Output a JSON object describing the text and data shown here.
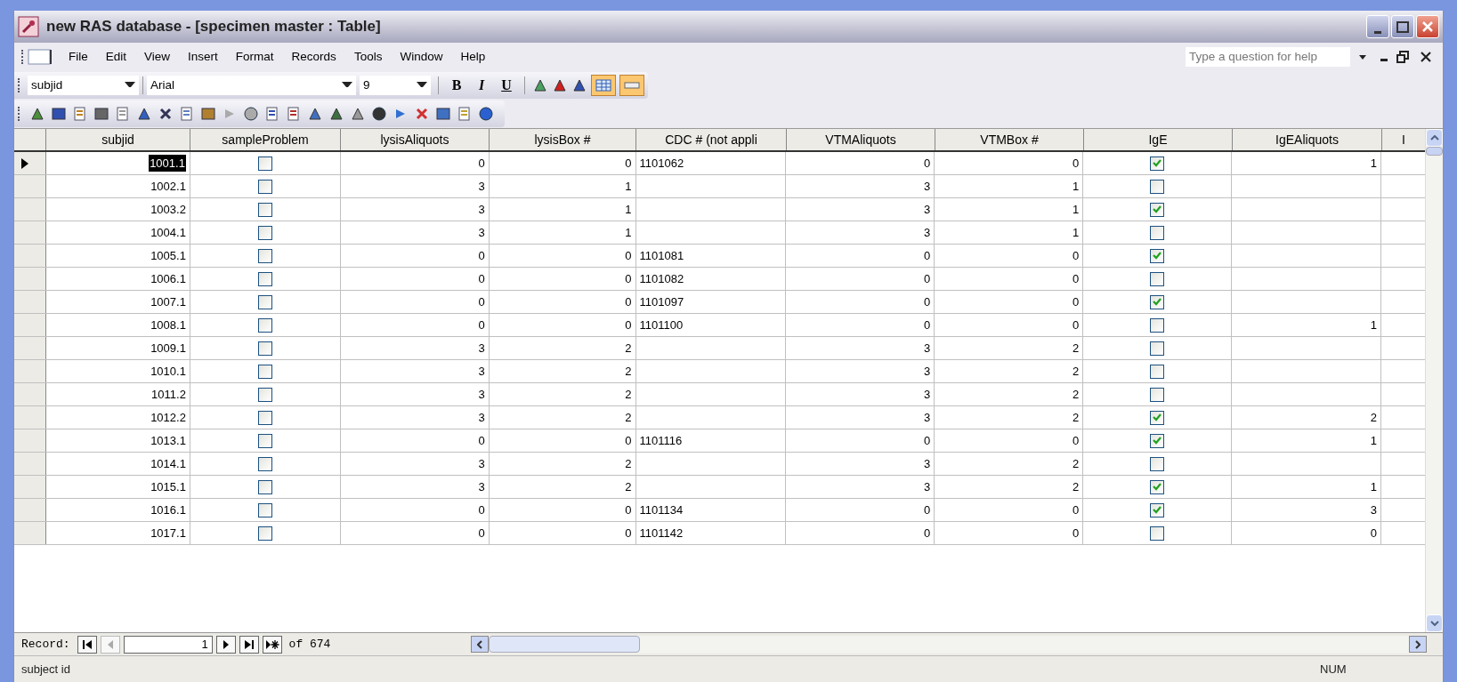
{
  "window": {
    "title": "new RAS database - [specimen master : Table]"
  },
  "menu": [
    {
      "label": "File"
    },
    {
      "label": "Edit"
    },
    {
      "label": "View"
    },
    {
      "label": "Insert"
    },
    {
      "label": "Format"
    },
    {
      "label": "Records"
    },
    {
      "label": "Tools"
    },
    {
      "label": "Window"
    },
    {
      "label": "Help"
    }
  ],
  "help_search": {
    "placeholder": "Type a question for help"
  },
  "formatting_toolbar": {
    "field": "subjid",
    "font": "Arial",
    "size": "9",
    "bold": "B",
    "italic": "I",
    "underline": "U"
  },
  "table": {
    "columns": [
      "subjid",
      "sampleProblem",
      "lysisAliquots",
      "lysisBox #",
      "CDC # (not appli",
      "VTMAliquots",
      "VTMBox #",
      "IgE",
      "IgEAliquots",
      "I"
    ],
    "rows": [
      {
        "selected": true,
        "subjid": "1001.1",
        "sample_problem": false,
        "lysis_aliquots": "0",
        "lysis_box": "0",
        "cdc": "1101062",
        "vtm_aliquots": "0",
        "vtm_box": "0",
        "ige": true,
        "ige_aliquots": "1"
      },
      {
        "selected": false,
        "subjid": "1002.1",
        "sample_problem": false,
        "lysis_aliquots": "3",
        "lysis_box": "1",
        "cdc": "",
        "vtm_aliquots": "3",
        "vtm_box": "1",
        "ige": false,
        "ige_aliquots": ""
      },
      {
        "selected": false,
        "subjid": "1003.2",
        "sample_problem": false,
        "lysis_aliquots": "3",
        "lysis_box": "1",
        "cdc": "",
        "vtm_aliquots": "3",
        "vtm_box": "1",
        "ige": true,
        "ige_aliquots": ""
      },
      {
        "selected": false,
        "subjid": "1004.1",
        "sample_problem": false,
        "lysis_aliquots": "3",
        "lysis_box": "1",
        "cdc": "",
        "vtm_aliquots": "3",
        "vtm_box": "1",
        "ige": false,
        "ige_aliquots": ""
      },
      {
        "selected": false,
        "subjid": "1005.1",
        "sample_problem": false,
        "lysis_aliquots": "0",
        "lysis_box": "0",
        "cdc": "1101081",
        "vtm_aliquots": "0",
        "vtm_box": "0",
        "ige": true,
        "ige_aliquots": ""
      },
      {
        "selected": false,
        "subjid": "1006.1",
        "sample_problem": false,
        "lysis_aliquots": "0",
        "lysis_box": "0",
        "cdc": "1101082",
        "vtm_aliquots": "0",
        "vtm_box": "0",
        "ige": false,
        "ige_aliquots": ""
      },
      {
        "selected": false,
        "subjid": "1007.1",
        "sample_problem": false,
        "lysis_aliquots": "0",
        "lysis_box": "0",
        "cdc": "1101097",
        "vtm_aliquots": "0",
        "vtm_box": "0",
        "ige": true,
        "ige_aliquots": ""
      },
      {
        "selected": false,
        "subjid": "1008.1",
        "sample_problem": false,
        "lysis_aliquots": "0",
        "lysis_box": "0",
        "cdc": "1101100",
        "vtm_aliquots": "0",
        "vtm_box": "0",
        "ige": false,
        "ige_aliquots": "1"
      },
      {
        "selected": false,
        "subjid": "1009.1",
        "sample_problem": false,
        "lysis_aliquots": "3",
        "lysis_box": "2",
        "cdc": "",
        "vtm_aliquots": "3",
        "vtm_box": "2",
        "ige": false,
        "ige_aliquots": ""
      },
      {
        "selected": false,
        "subjid": "1010.1",
        "sample_problem": false,
        "lysis_aliquots": "3",
        "lysis_box": "2",
        "cdc": "",
        "vtm_aliquots": "3",
        "vtm_box": "2",
        "ige": false,
        "ige_aliquots": ""
      },
      {
        "selected": false,
        "subjid": "1011.2",
        "sample_problem": false,
        "lysis_aliquots": "3",
        "lysis_box": "2",
        "cdc": "",
        "vtm_aliquots": "3",
        "vtm_box": "2",
        "ige": false,
        "ige_aliquots": ""
      },
      {
        "selected": false,
        "subjid": "1012.2",
        "sample_problem": false,
        "lysis_aliquots": "3",
        "lysis_box": "2",
        "cdc": "",
        "vtm_aliquots": "3",
        "vtm_box": "2",
        "ige": true,
        "ige_aliquots": "2"
      },
      {
        "selected": false,
        "subjid": "1013.1",
        "sample_problem": false,
        "lysis_aliquots": "0",
        "lysis_box": "0",
        "cdc": "1101116",
        "vtm_aliquots": "0",
        "vtm_box": "0",
        "ige": true,
        "ige_aliquots": "1"
      },
      {
        "selected": false,
        "subjid": "1014.1",
        "sample_problem": false,
        "lysis_aliquots": "3",
        "lysis_box": "2",
        "cdc": "",
        "vtm_aliquots": "3",
        "vtm_box": "2",
        "ige": false,
        "ige_aliquots": ""
      },
      {
        "selected": false,
        "subjid": "1015.1",
        "sample_problem": false,
        "lysis_aliquots": "3",
        "lysis_box": "2",
        "cdc": "",
        "vtm_aliquots": "3",
        "vtm_box": "2",
        "ige": true,
        "ige_aliquots": "1"
      },
      {
        "selected": false,
        "subjid": "1016.1",
        "sample_problem": false,
        "lysis_aliquots": "0",
        "lysis_box": "0",
        "cdc": "1101134",
        "vtm_aliquots": "0",
        "vtm_box": "0",
        "ige": true,
        "ige_aliquots": "3"
      },
      {
        "selected": false,
        "subjid": "1017.1",
        "sample_problem": false,
        "lysis_aliquots": "0",
        "lysis_box": "0",
        "cdc": "1101142",
        "vtm_aliquots": "0",
        "vtm_box": "0",
        "ige": false,
        "ige_aliquots": "0"
      }
    ]
  },
  "record_navigator": {
    "label": "Record:",
    "current": "1",
    "total": "of 674"
  },
  "status_bar": {
    "message": "subject id",
    "num": "NUM"
  }
}
